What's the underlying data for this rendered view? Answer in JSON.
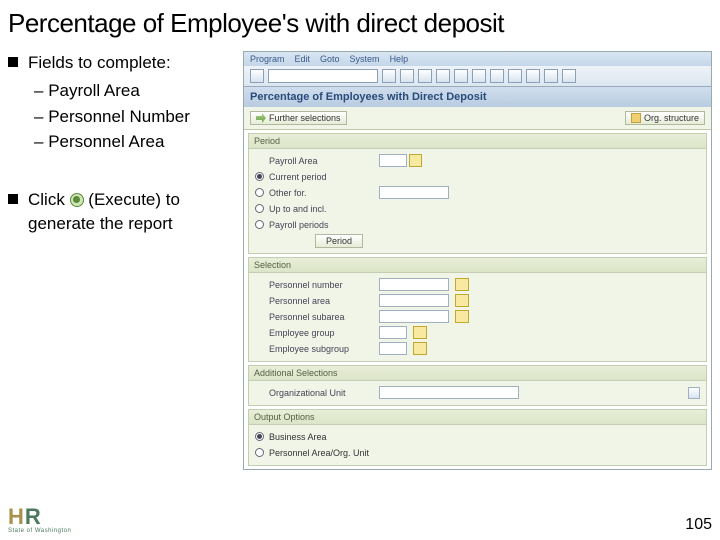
{
  "title": "Percentage of Employee's with direct deposit",
  "left": {
    "fields_label": "Fields to complete:",
    "fields": [
      "Payroll Area",
      "Personnel Number",
      "Personnel Area"
    ],
    "click_prefix": "Click ",
    "click_suffix": "(Execute) to generate the report"
  },
  "sap": {
    "menu": [
      "Program",
      "Edit",
      "Goto",
      "System",
      "Help"
    ],
    "report_title": "Percentage of Employees with Direct Deposit",
    "further_selections": "Further selections",
    "org_structure": "Org. structure",
    "panels": {
      "period": {
        "title": "Period",
        "payroll_area": "Payroll Area",
        "radios": [
          "Current period",
          "Other for.",
          "Up to and incl.",
          "Payroll periods"
        ],
        "period_btn": "Period"
      },
      "selection": {
        "title": "Selection",
        "rows": [
          "Personnel number",
          "Personnel area",
          "Personnel subarea",
          "Employee group",
          "Employee subgroup"
        ]
      },
      "additional": {
        "title": "Additional Selections",
        "org_unit": "Organizational Unit"
      },
      "output": {
        "title": "Output Options",
        "radios": [
          "Business Area",
          "Personnel Area/Org. Unit"
        ]
      }
    }
  },
  "footer": {
    "logo_h": "H",
    "logo_r": "R",
    "logo_sub": "State of Washington",
    "page": "105"
  }
}
